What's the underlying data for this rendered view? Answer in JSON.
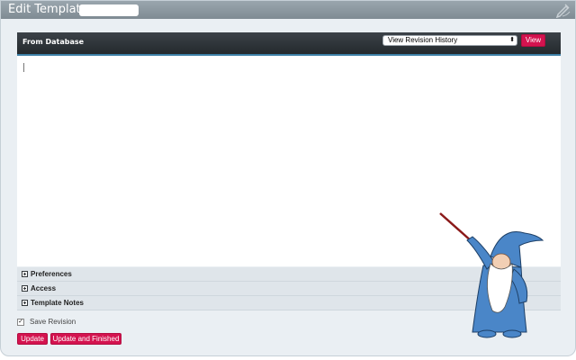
{
  "window": {
    "title": "Edit Template:"
  },
  "editor": {
    "source_label": "From Database",
    "revision_select_value": "View Revision History",
    "view_button": "View"
  },
  "sections": [
    {
      "label": "Preferences"
    },
    {
      "label": "Access"
    },
    {
      "label": "Template Notes"
    }
  ],
  "save_revision": {
    "label": "Save Revision",
    "checked": true
  },
  "buttons": {
    "update": "Update",
    "update_finished": "Update and Finished"
  },
  "colors": {
    "accent": "#d4134f",
    "header_bg": "#2d3338",
    "window_bg": "#eaeff3"
  },
  "icons": {
    "title_right": "edit-pen-icon",
    "mascot": "wizard-mascot"
  }
}
